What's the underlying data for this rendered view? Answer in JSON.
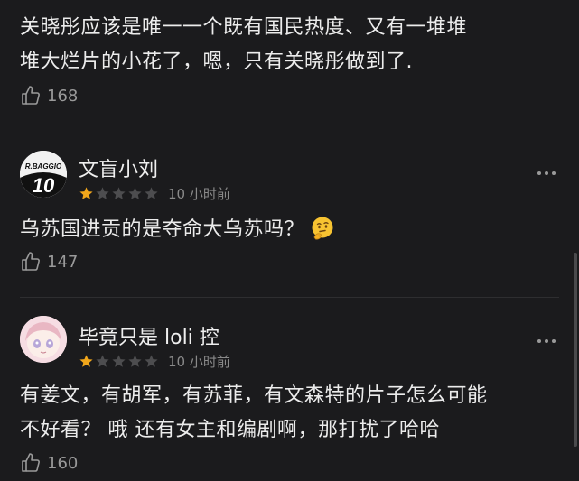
{
  "comments": [
    {
      "text_line1": "关晓彤应该是唯一一个既有国民热度、又有一堆堆",
      "text_line2": "堆大烂片的小花了，嗯，只有关晓彤做到了.",
      "likes": "168"
    },
    {
      "username": "文盲小刘",
      "avatar_text": "R.BAGGIO 10",
      "stars": 1,
      "time": "10 小时前",
      "text": "乌苏国进贡的是夺命大乌苏吗？",
      "emoji": "thinking-face",
      "likes": "147"
    },
    {
      "username": "毕竟只是 loli 控",
      "stars": 1,
      "time": "10 小时前",
      "text_line1": "有姜文，有胡军，有苏菲，有文森特的片子怎么可能",
      "text_line2": "不好看？  哦 还有女主和编剧啊，那打扰了哈哈",
      "likes": "160"
    }
  ],
  "colors": {
    "background": "#1b1b1d",
    "star_filled": "#f2a71b",
    "star_empty": "#4d4d4f"
  }
}
